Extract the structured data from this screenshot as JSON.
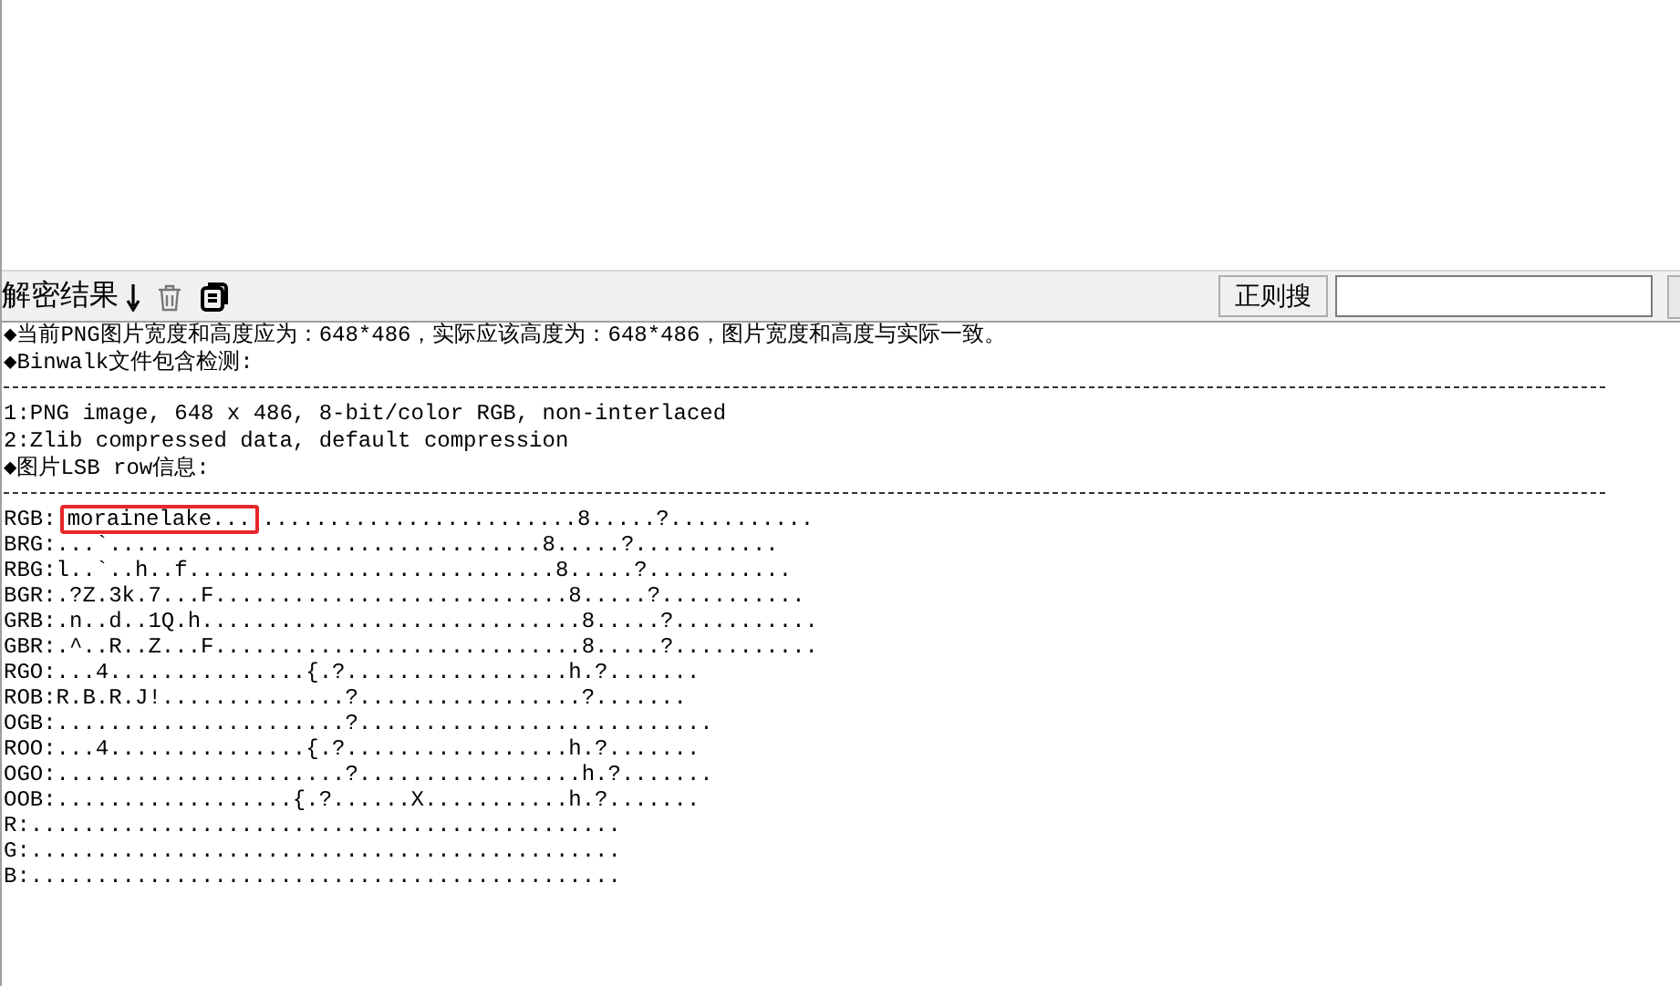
{
  "toolbar": {
    "title": "解密结果",
    "search_button": "正则搜"
  },
  "output": {
    "lines": [
      {
        "kind": "text",
        "text": "◆当前PNG图片宽度和高度应为：648*486，实际应该高度为：648*486，图片宽度和高度与实际一致。"
      },
      {
        "kind": "text",
        "text": "◆Binwalk文件包含检测:"
      },
      {
        "kind": "rule"
      },
      {
        "kind": "text",
        "text": "1:PNG image, 648 x 486, 8-bit/color RGB, non-interlaced"
      },
      {
        "kind": "text",
        "text": "2:Zlib compressed data, default compression"
      },
      {
        "kind": "text",
        "text": "◆图片LSB row信息:"
      },
      {
        "kind": "rule"
      }
    ],
    "rows": [
      {
        "text": "RGB:",
        "highlight": "morainelake...",
        "after": "........................8.....?..........."
      },
      {
        "text": "BRG:...`.................................8.....?..........."
      },
      {
        "text": "RBG:l..`..h..f............................8.....?..........."
      },
      {
        "text": "BGR:.?Z.3k.7...F...........................8.....?..........."
      },
      {
        "text": "GRB:.n..d..1Q.h.............................8.....?..........."
      },
      {
        "text": "GBR:.^..R..Z...F............................8.....?..........."
      },
      {
        "text": "RGO:...4...............{.?.................h.?......."
      },
      {
        "text": "ROB:R.B.R.J!..............?.................?......."
      },
      {
        "text": "OGB:......................?..........................."
      },
      {
        "text": "ROO:...4...............{.?.................h.?......."
      },
      {
        "text": "OGO:......................?.................h.?......."
      },
      {
        "text": "OOB:..................{.?......X...........h.?......."
      },
      {
        "text": "R:............................................."
      },
      {
        "text": "G:............................................."
      },
      {
        "text": "B:............................................."
      }
    ]
  }
}
